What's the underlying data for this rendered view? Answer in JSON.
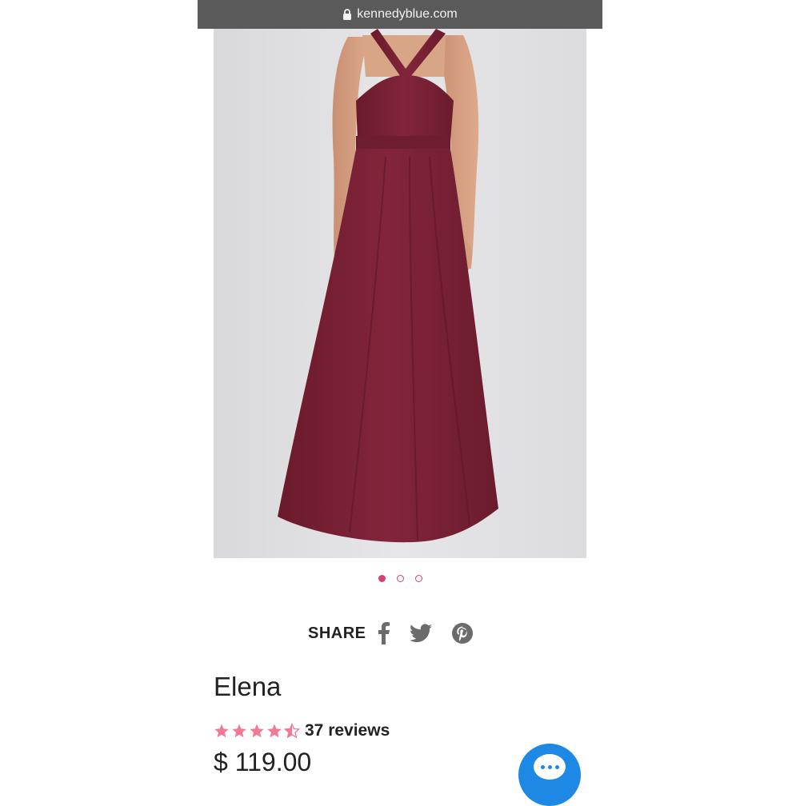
{
  "browser": {
    "url": "kennedyblue.com"
  },
  "gallery": {
    "image_alt": "burgundy halter long dress",
    "dots": [
      {
        "active": true
      },
      {
        "active": false
      },
      {
        "active": false
      }
    ],
    "accent": "#d93f73",
    "dress_color": "#7a1f34"
  },
  "share": {
    "label": "SHARE",
    "icons": [
      "facebook-icon",
      "twitter-icon",
      "pinterest-icon"
    ]
  },
  "product": {
    "name": "Elena",
    "rating": 4.5,
    "rating_max": 5,
    "reviews": "37 reviews",
    "price": "$ 119.00",
    "star_color": "#f07a96"
  },
  "chat": {
    "icon": "chat-icon",
    "color": "#1e88e5"
  }
}
